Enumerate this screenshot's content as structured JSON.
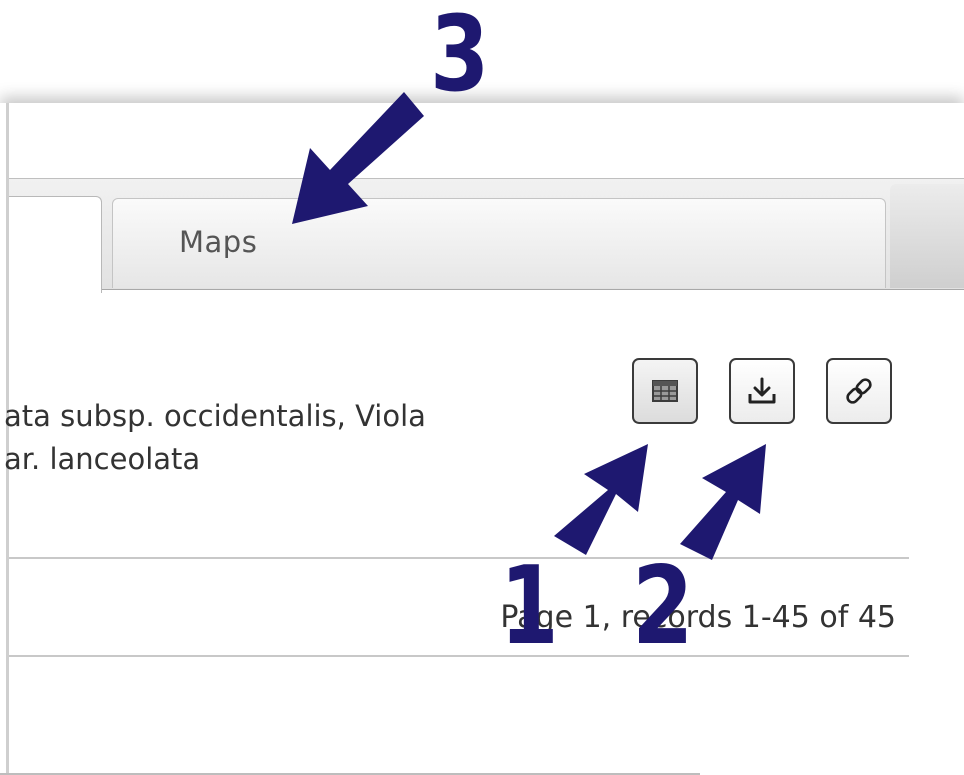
{
  "tabs": {
    "maps_label": "Maps"
  },
  "description": {
    "line1": "ata subsp. occidentalis, Viola",
    "line2": "ar. lanceolata"
  },
  "toolbar": {
    "buttons": [
      {
        "icon": "table-icon"
      },
      {
        "icon": "download-icon"
      },
      {
        "icon": "link-icon"
      }
    ]
  },
  "pager": {
    "text": "Page 1, records 1-45 of 45"
  },
  "annotations": {
    "labels": [
      "1",
      "2",
      "3"
    ],
    "color": "#1e1870"
  }
}
